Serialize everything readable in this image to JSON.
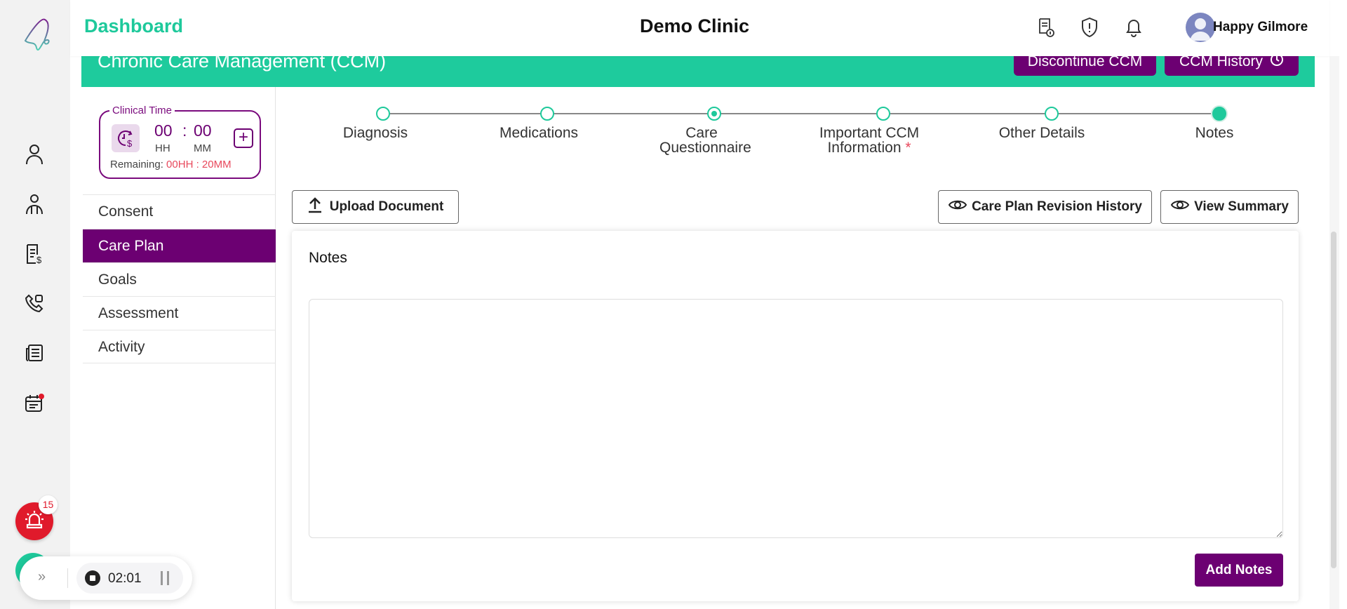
{
  "header": {
    "title": "Dashboard",
    "clinic": "Demo Clinic",
    "user_name": "Happy Gilmore"
  },
  "banner": {
    "title": "Chronic Care Management (CCM)",
    "discontinue": "Discontinue CCM",
    "history": "CCM History"
  },
  "clinical_time": {
    "label": "Clinical Time",
    "hh": "00",
    "sep": ":",
    "mm": "00",
    "hh_label": "HH",
    "mm_label": "MM",
    "remaining_label": "Remaining:",
    "remaining_value": "00HH : 20MM"
  },
  "menu": [
    {
      "label": "Consent"
    },
    {
      "label": "Care Plan",
      "active": true
    },
    {
      "label": "Goals"
    },
    {
      "label": "Assessment"
    },
    {
      "label": "Activity"
    }
  ],
  "steps": [
    {
      "label": "Diagnosis"
    },
    {
      "label": "Medications"
    },
    {
      "label": "Care Questionnaire"
    },
    {
      "label": "Important CCM Information",
      "required": "*"
    },
    {
      "label": "Other Details"
    },
    {
      "label": "Notes"
    }
  ],
  "actions": {
    "upload": "Upload Document",
    "revision": "Care Plan Revision History",
    "summary": "View Summary"
  },
  "notes": {
    "title": "Notes",
    "value": "",
    "add": "Add Notes"
  },
  "alerts": {
    "count": "15"
  },
  "recorder": {
    "time": "02:01",
    "expand": "»"
  },
  "colors": {
    "brand_green": "#1ec99b",
    "brand_purple": "#6c0072",
    "alert_red": "#e01a2b"
  }
}
